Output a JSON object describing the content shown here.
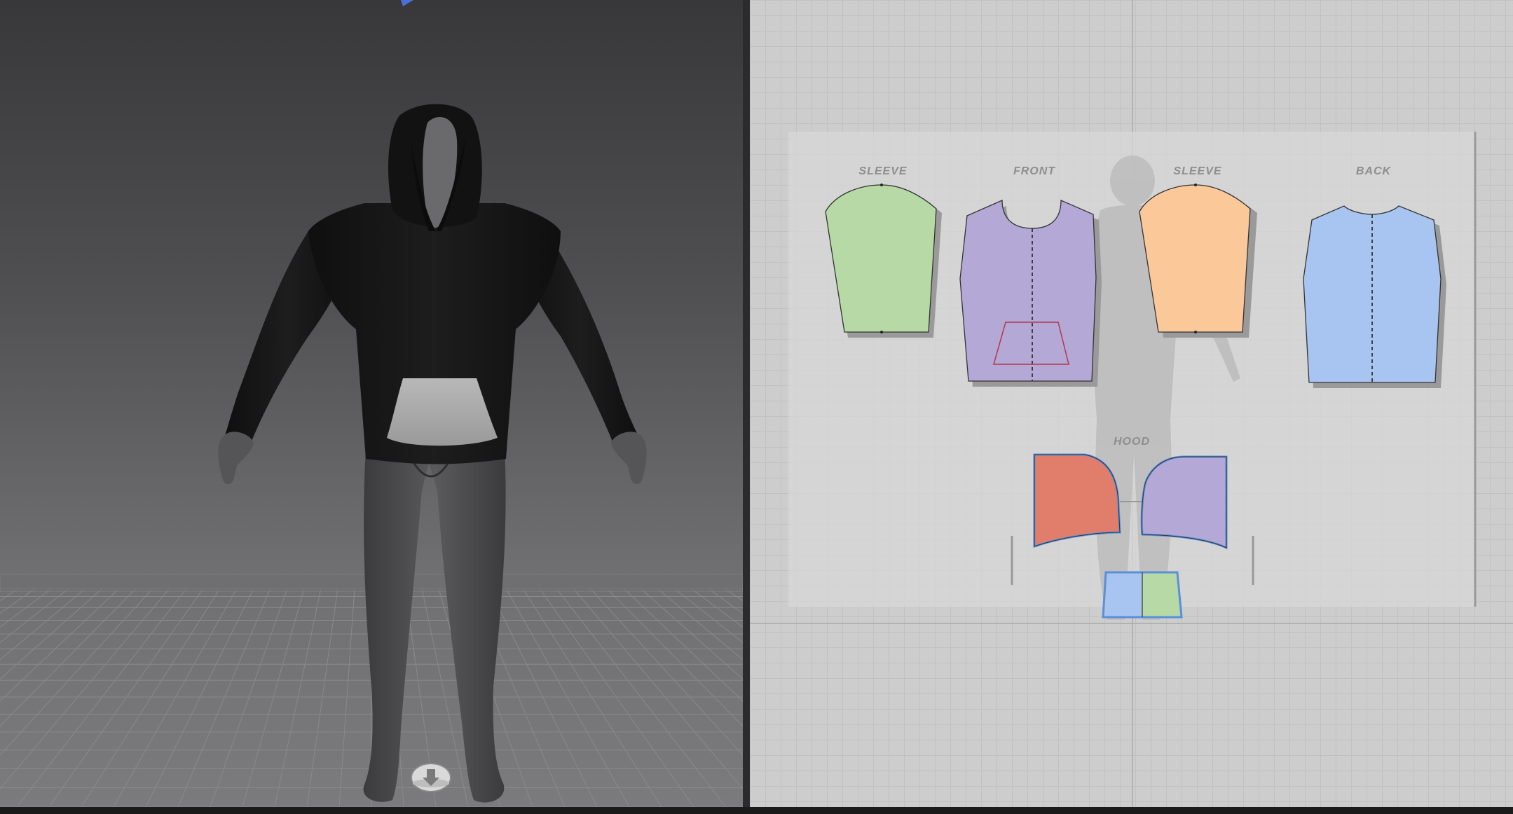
{
  "viewport_3d": {
    "avatar": "male-avatar",
    "garment": "hoodie",
    "colors": {
      "background_top": "#38383a",
      "background_bottom": "#7b7b7d",
      "hoodie": "#161617",
      "pocket": "#a9a9a9",
      "avatar_skin": "#4d4d4f",
      "floor_grid": "#8a8a8c"
    },
    "icons": {
      "gizmo": "arrow-icon",
      "avatar_hotspot": "avatar-hotspot-icon"
    }
  },
  "viewport_2d": {
    "labels": {
      "sleeve_left": "SLEEVE",
      "front": "FRONT",
      "sleeve_right": "SLEEVE",
      "back": "BACK",
      "hood": "HOOD"
    },
    "colors": {
      "canvas": "#cdcdcd",
      "grid_line": "#c1c1c1",
      "sleeve_left": "#b6d9a6",
      "front": "#b4a8d6",
      "sleeve_right": "#fbc89a",
      "back": "#a8c4f1",
      "hood_left": "#e07d6b",
      "hood_right": "#b4a8d6",
      "gusset_left": "#a8c4f1",
      "gusset_right": "#b6d9a6",
      "pocket_outline": "#b2384c",
      "selected_outline": "#5b8fd8"
    }
  }
}
